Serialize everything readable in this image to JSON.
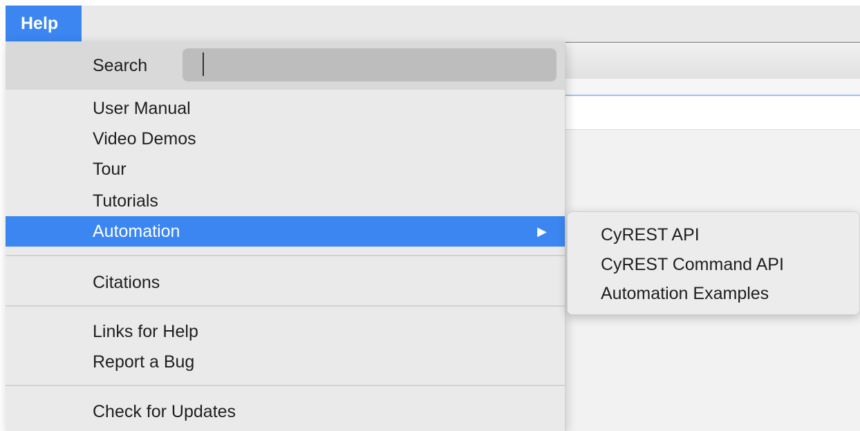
{
  "menubar": {
    "active_menu": "Help"
  },
  "help_menu": {
    "search": {
      "label": "Search",
      "value": "",
      "placeholder": ""
    },
    "items": [
      {
        "label": "User Manual"
      },
      {
        "label": "Video Demos"
      },
      {
        "label": "Tour"
      },
      {
        "label": "Tutorials"
      },
      {
        "label": "Automation",
        "submenu_arrow": "▶"
      },
      {
        "label": "Citations"
      },
      {
        "label": "Links for Help"
      },
      {
        "label": "Report a Bug"
      },
      {
        "label": "Check for Updates"
      }
    ]
  },
  "automation_submenu": {
    "items": [
      {
        "label": "CyREST API"
      },
      {
        "label": "CyREST Command API"
      },
      {
        "label": "Automation Examples"
      }
    ]
  },
  "colors": {
    "highlight": "#3b86f0",
    "menu_background": "#eaeaea",
    "search_row_background": "#d9d9d9"
  },
  "icons": {
    "submenu_arrow": "triangle-right-icon"
  }
}
